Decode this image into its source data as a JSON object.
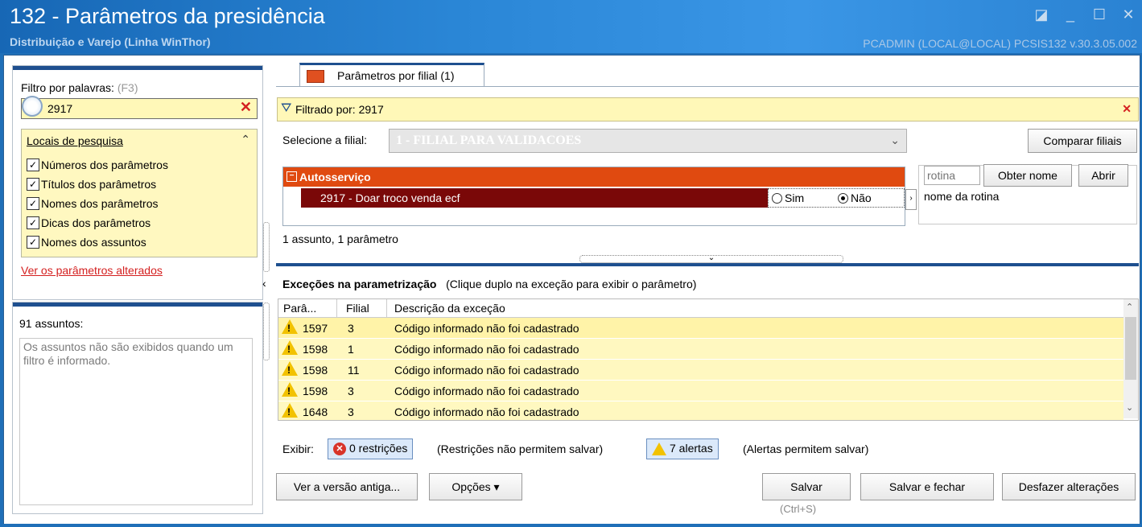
{
  "window": {
    "title": "132 - Parâmetros da presidência",
    "subtitle": "Distribuição e Varejo (Linha WinThor)",
    "user_info": "PCADMIN (LOCAL@LOCAL)   PCSIS132  v.30.3.05.002",
    "buttons": {
      "restore": "◪",
      "minimize": "_",
      "maximize": "☐",
      "close": "✕"
    }
  },
  "filter": {
    "label": "Filtro por palavras:",
    "shortcut": "(F3)",
    "value": "2917",
    "clear": "✕",
    "locais_title": "Locais de pesquisa",
    "collapse": "⌃",
    "options": [
      {
        "label": "Números dos parâmetros",
        "checked": true
      },
      {
        "label": "Títulos dos parâmetros",
        "checked": true
      },
      {
        "label": "Nomes dos parâmetros",
        "checked": true
      },
      {
        "label": "Dicas dos parâmetros",
        "checked": true
      },
      {
        "label": "Nomes dos assuntos",
        "checked": true
      }
    ],
    "changed_link": "Ver os parâmetros alterados"
  },
  "subjects": {
    "count_label": "91 assuntos:",
    "message": "Os assuntos não são exibidos quando um filtro é informado."
  },
  "tab": {
    "label": "Parâmetros por filial  (1)"
  },
  "filtered": {
    "label": "Filtrado por: 2917",
    "close": "✕"
  },
  "branch": {
    "label": "Selecione a filial:",
    "value": "1 - FILIAL PARA VALIDACOES",
    "compare_button": "Comparar filiais"
  },
  "tree": {
    "group": "Autosserviço",
    "param": "2917 - Doar troco venda ecf",
    "option_yes": "Sim",
    "option_no": "Não",
    "selected": "Não",
    "summary": "1 assunto, 1 parâmetro"
  },
  "routine": {
    "placeholder": "rotina",
    "get_name_button": "Obter nome",
    "open_button": "Abrir",
    "name_label": "nome da rotina"
  },
  "exceptions": {
    "title": "Exceções na parametrização",
    "hint": "(Clique duplo na exceção para exibir o parâmetro)",
    "columns": [
      "Parâ...",
      "Filial",
      "Descrição da exceção"
    ],
    "rows": [
      {
        "param": "1597",
        "filial": "3",
        "desc": "Código informado não foi cadastrado"
      },
      {
        "param": "1598",
        "filial": "1",
        "desc": "Código informado não foi cadastrado"
      },
      {
        "param": "1598",
        "filial": "11",
        "desc": "Código informado não foi cadastrado"
      },
      {
        "param": "1598",
        "filial": "3",
        "desc": "Código informado não foi cadastrado"
      },
      {
        "param": "1648",
        "filial": "3",
        "desc": "Código informado não foi cadastrado"
      }
    ],
    "show_label": "Exibir:",
    "restrictions": "0 restrições",
    "restrictions_note": "(Restrições não permitem salvar)",
    "alerts": "7 alertas",
    "alerts_note": "(Alertas permitem salvar)"
  },
  "footer": {
    "old_version": "Ver a versão antiga...",
    "options": "Opções ▾",
    "save": "Salvar",
    "save_shortcut": "(Ctrl+S)",
    "save_close": "Salvar e fechar",
    "undo": "Desfazer alterações"
  }
}
